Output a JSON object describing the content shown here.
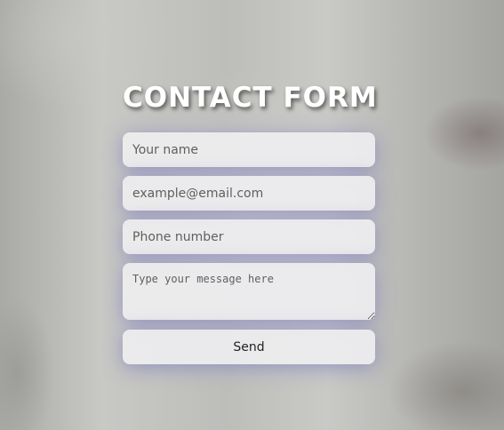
{
  "form": {
    "title": "CONTACT FORM",
    "name_placeholder": "Your name",
    "email_placeholder": "example@email.com",
    "phone_placeholder": "Phone number",
    "message_placeholder": "Type your message here",
    "send_label": "Send"
  },
  "colors": {
    "title": "#ffffff",
    "field_background": "#eeeef0",
    "field_glow": "#6e6ebe"
  }
}
